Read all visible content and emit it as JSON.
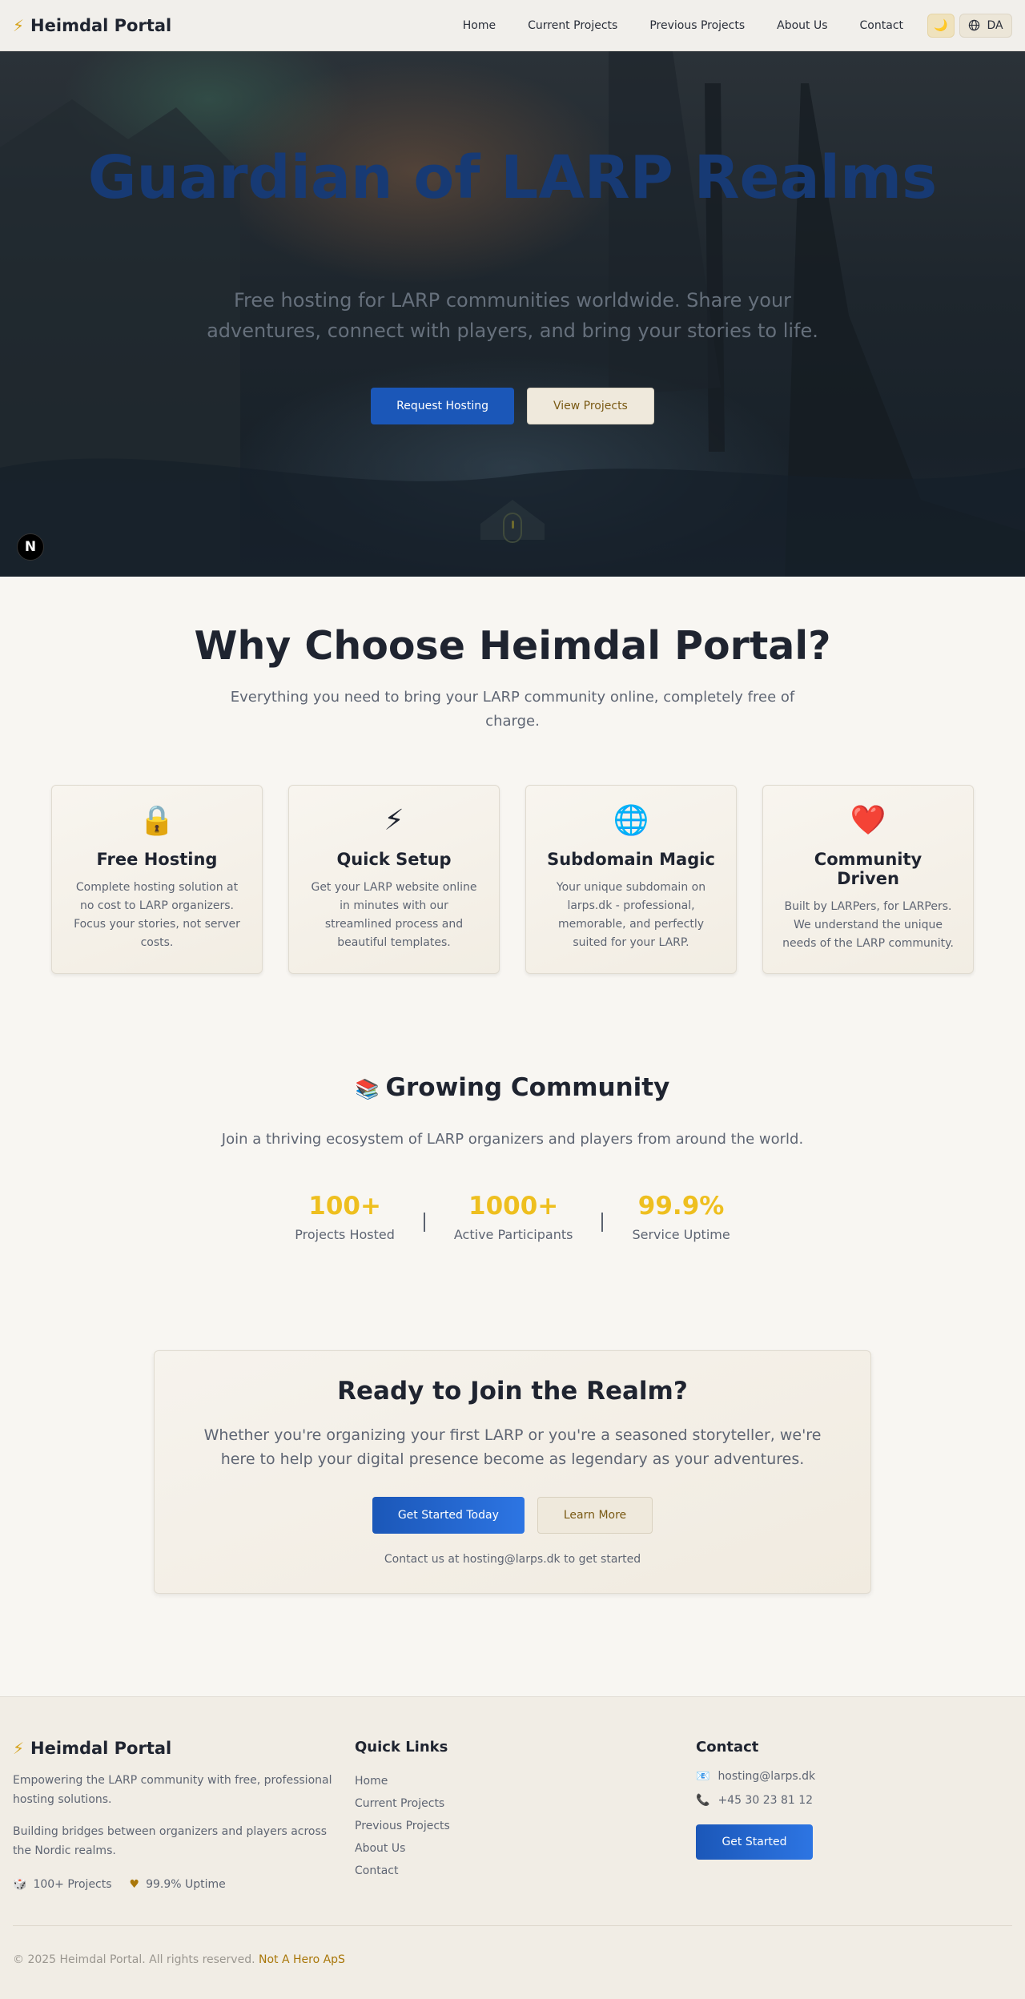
{
  "nav": {
    "brand": "Heimdal Portal",
    "links": [
      "Home",
      "Current Projects",
      "Previous Projects",
      "About Us",
      "Contact"
    ],
    "theme_icon": "moon-icon",
    "language": "DA"
  },
  "hero": {
    "title": "Guardian of LARP Realms",
    "subtitle": "Free hosting for LARP communities worldwide. Share your adventures, connect with players, and bring your stories to life.",
    "primary_button": "Request Hosting",
    "secondary_button": "View Projects",
    "badge": "N"
  },
  "why": {
    "title": "Why Choose Heimdal Portal?",
    "subtitle": "Everything you need to bring your LARP community online, completely free of charge.",
    "features": [
      {
        "icon": "🔒",
        "title": "Free Hosting",
        "text": "Complete hosting solution at no cost to LARP organizers. Focus your stories, not server costs."
      },
      {
        "icon": "⚡",
        "title": "Quick Setup",
        "text": "Get your LARP website online in minutes with our streamlined process and beautiful templates."
      },
      {
        "icon": "🌐",
        "title": "Subdomain Magic",
        "text": "Your unique subdomain on larps.dk - professional, memorable, and perfectly suited for your LARP."
      },
      {
        "icon": "❤️",
        "title": "Community Driven",
        "text": "Built by LARPers, for LARPers. We understand the unique needs of the LARP community."
      }
    ]
  },
  "community": {
    "icon": "📚",
    "title": "Growing Community",
    "subtitle": "Join a thriving ecosystem of LARP organizers and players from around the world.",
    "stats": [
      {
        "value": "100+",
        "label": "Projects Hosted"
      },
      {
        "value": "1000+",
        "label": "Active Participants"
      },
      {
        "value": "99.9%",
        "label": "Service Uptime"
      }
    ]
  },
  "cta": {
    "title": "Ready to Join the Realm?",
    "subtitle": "Whether you're organizing your first LARP or you're a seasoned storyteller, we're here to help your digital presence become as legendary as your adventures.",
    "primary_button": "Get Started Today",
    "secondary_button": "Learn More",
    "note": "Contact us at hosting@larps.dk to get started"
  },
  "footer": {
    "brand": "Heimdal Portal",
    "para1": "Empowering the LARP community with free, professional hosting solutions.",
    "para2": "Building bridges between organizers and players across the Nordic realms.",
    "badges": [
      {
        "icon": "🎲",
        "label": "100+ Projects"
      },
      {
        "icon": "♥",
        "label": "99.9% Uptime"
      }
    ],
    "quick_links_title": "Quick Links",
    "quick_links": [
      "Home",
      "Current Projects",
      "Previous Projects",
      "About Us",
      "Contact"
    ],
    "contact_title": "Contact",
    "email": "hosting@larps.dk",
    "phone": "+45 30 23 81 12",
    "email_icon": "📧",
    "phone_icon": "📞",
    "cta_button": "Get Started",
    "copyright": "© 2025 Heimdal Portal. All rights reserved.",
    "company": "Not A Hero ApS"
  }
}
